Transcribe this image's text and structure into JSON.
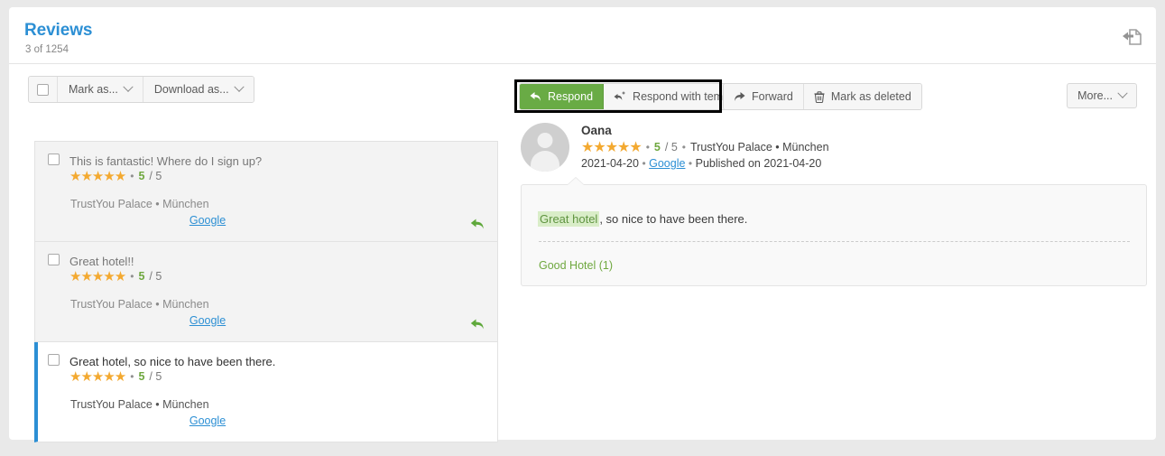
{
  "header": {
    "title": "Reviews",
    "subtitle": "3 of 1254",
    "action_icon": "reply-document-icon"
  },
  "left_toolbar": {
    "select_all_checkbox": "select-all-checkbox",
    "mark_as_label": "Mark as...",
    "download_as_label": "Download as..."
  },
  "action_toolbar": {
    "respond_label": "Respond",
    "respond_icon": "reply-arrow-icon",
    "respond_with_template_label": "Respond with template",
    "respond_with_template_icon": "reply-template-icon",
    "forward_label": "Forward",
    "forward_icon": "forward-arrow-icon",
    "mark_as_deleted_label": "Mark as deleted",
    "mark_as_deleted_icon": "trash-icon",
    "more_label": "More...",
    "highlighted_group": "respond-buttons"
  },
  "review_list": [
    {
      "title": "This is fantastic! Where do I sign up?",
      "stars": "★★★★★",
      "score": "5",
      "score_den": "/ 5",
      "property": "TrustYou Palace • München",
      "source": "Google",
      "has_reply": true,
      "selected": false
    },
    {
      "title": "Great hotel!!",
      "stars": "★★★★★",
      "score": "5",
      "score_den": "/ 5",
      "property": "TrustYou Palace • München",
      "source": "Google",
      "has_reply": true,
      "selected": false
    },
    {
      "title": "Great hotel, so nice to have been there.",
      "stars": "★★★★★",
      "score": "5",
      "score_den": "/ 5",
      "property": "TrustYou Palace • München",
      "source": "Google",
      "has_reply": false,
      "selected": true
    }
  ],
  "detail": {
    "author": "Oana",
    "stars": "★★★★★",
    "score": "5",
    "score_den": "/ 5",
    "separator": "•",
    "property": "TrustYou Palace • München",
    "date": "2021-04-20",
    "source": "Google",
    "published": "Published on 2021-04-20",
    "body_highlight": "Great hotel",
    "body_rest": ", so nice to have been there.",
    "category_tag": "Good Hotel (1)"
  },
  "colors": {
    "accent_blue": "#2c8fd4",
    "primary_green": "#69ab45",
    "star_amber": "#f3a930",
    "highlight_green_bg": "#d9edc8",
    "page_bg": "#e9e9e9"
  }
}
